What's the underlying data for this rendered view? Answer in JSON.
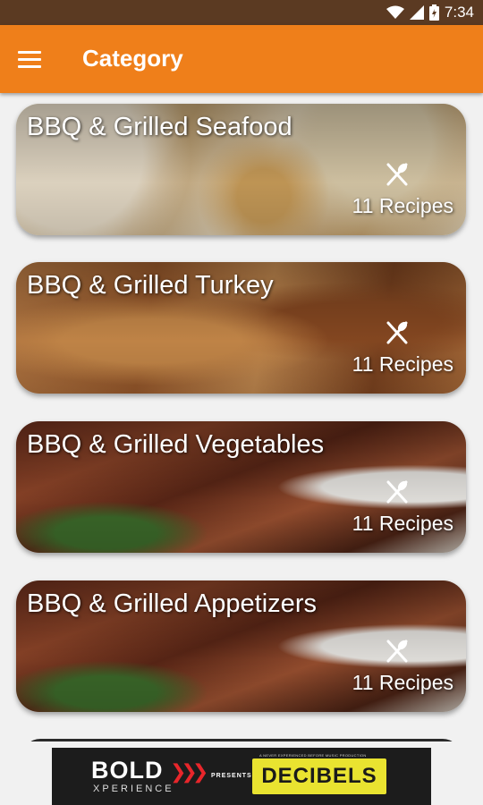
{
  "status_bar": {
    "time": "7:34"
  },
  "app_bar": {
    "title": "Category",
    "menu_icon": "hamburger-menu-icon"
  },
  "categories": [
    {
      "title": "BBQ & Grilled Seafood",
      "count": "11 Recipes",
      "icon": "fork-knife-icon"
    },
    {
      "title": "BBQ & Grilled Turkey",
      "count": "11 Recipes",
      "icon": "fork-knife-icon"
    },
    {
      "title": "BBQ & Grilled Vegetables",
      "count": "11 Recipes",
      "icon": "fork-knife-icon"
    },
    {
      "title": "BBQ & Grilled Appetizers",
      "count": "11 Recipes",
      "icon": "fork-knife-icon"
    }
  ],
  "ad": {
    "brand": "BOLD",
    "brand_sub": "XPERIENCE",
    "presents": "PRESENTS",
    "tagline": "A NEVER EXPERIENCED BEFORE MUSIC PRODUCTION",
    "event": "DECIBELS"
  },
  "colors": {
    "app_bar": "#ef7f1a",
    "status_bar": "#5b3a22"
  }
}
